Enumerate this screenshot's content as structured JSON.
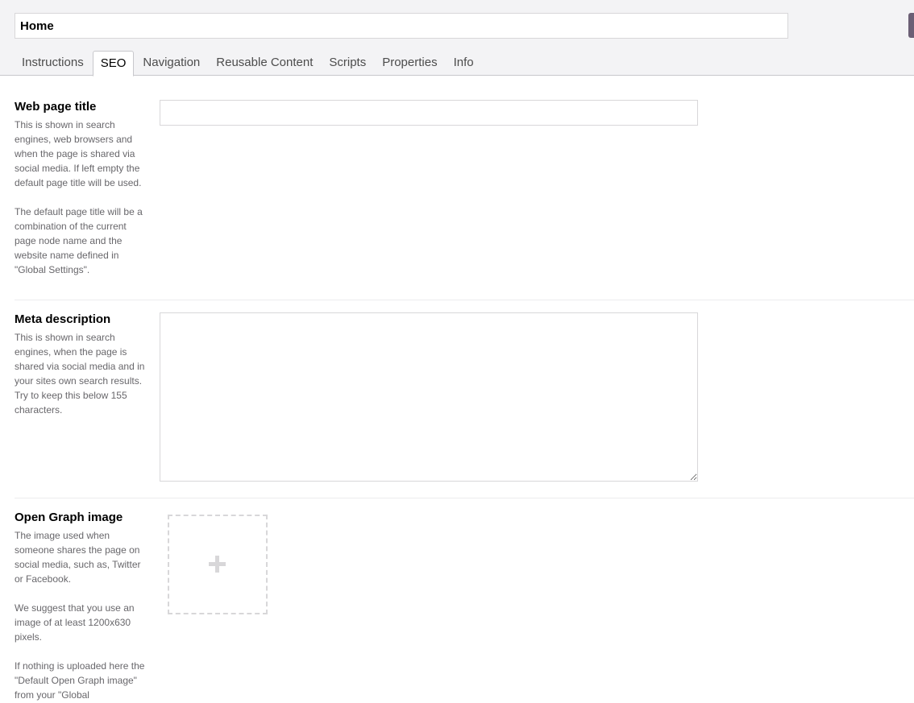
{
  "header": {
    "node_name": "Home",
    "tabs": [
      {
        "label": "Instructions",
        "active": false
      },
      {
        "label": "SEO",
        "active": true
      },
      {
        "label": "Navigation",
        "active": false
      },
      {
        "label": "Reusable Content",
        "active": false
      },
      {
        "label": "Scripts",
        "active": false
      },
      {
        "label": "Properties",
        "active": false
      },
      {
        "label": "Info",
        "active": false
      }
    ]
  },
  "properties": {
    "web_page_title": {
      "label": "Web page title",
      "description": [
        "This is shown in search engines, web browsers and when the page is shared via social media. If left empty the default page title will be used.",
        "The default page title will be a combination of the current page node name and the website name defined in \"Global Settings\"."
      ],
      "value": ""
    },
    "meta_description": {
      "label": "Meta description",
      "description": [
        "This is shown in search engines, when the page is shared via social media and in your sites own search results. Try to keep this below 155 characters."
      ],
      "value": ""
    },
    "open_graph_image": {
      "label": "Open Graph image",
      "description": [
        "The image used when someone shares the page on social media, such as, Twitter or Facebook.",
        "We suggest that you use an image of at least 1200x630 pixels.",
        "If nothing is uploaded here the \"Default Open Graph image\" from your \"Global"
      ],
      "add_icon": "plus-icon"
    }
  },
  "colors": {
    "header_bg": "#f3f3f5",
    "label_text": "#000000",
    "description_text": "#68676b",
    "border": "#d8d7d9",
    "handle": "#6b5f75"
  }
}
